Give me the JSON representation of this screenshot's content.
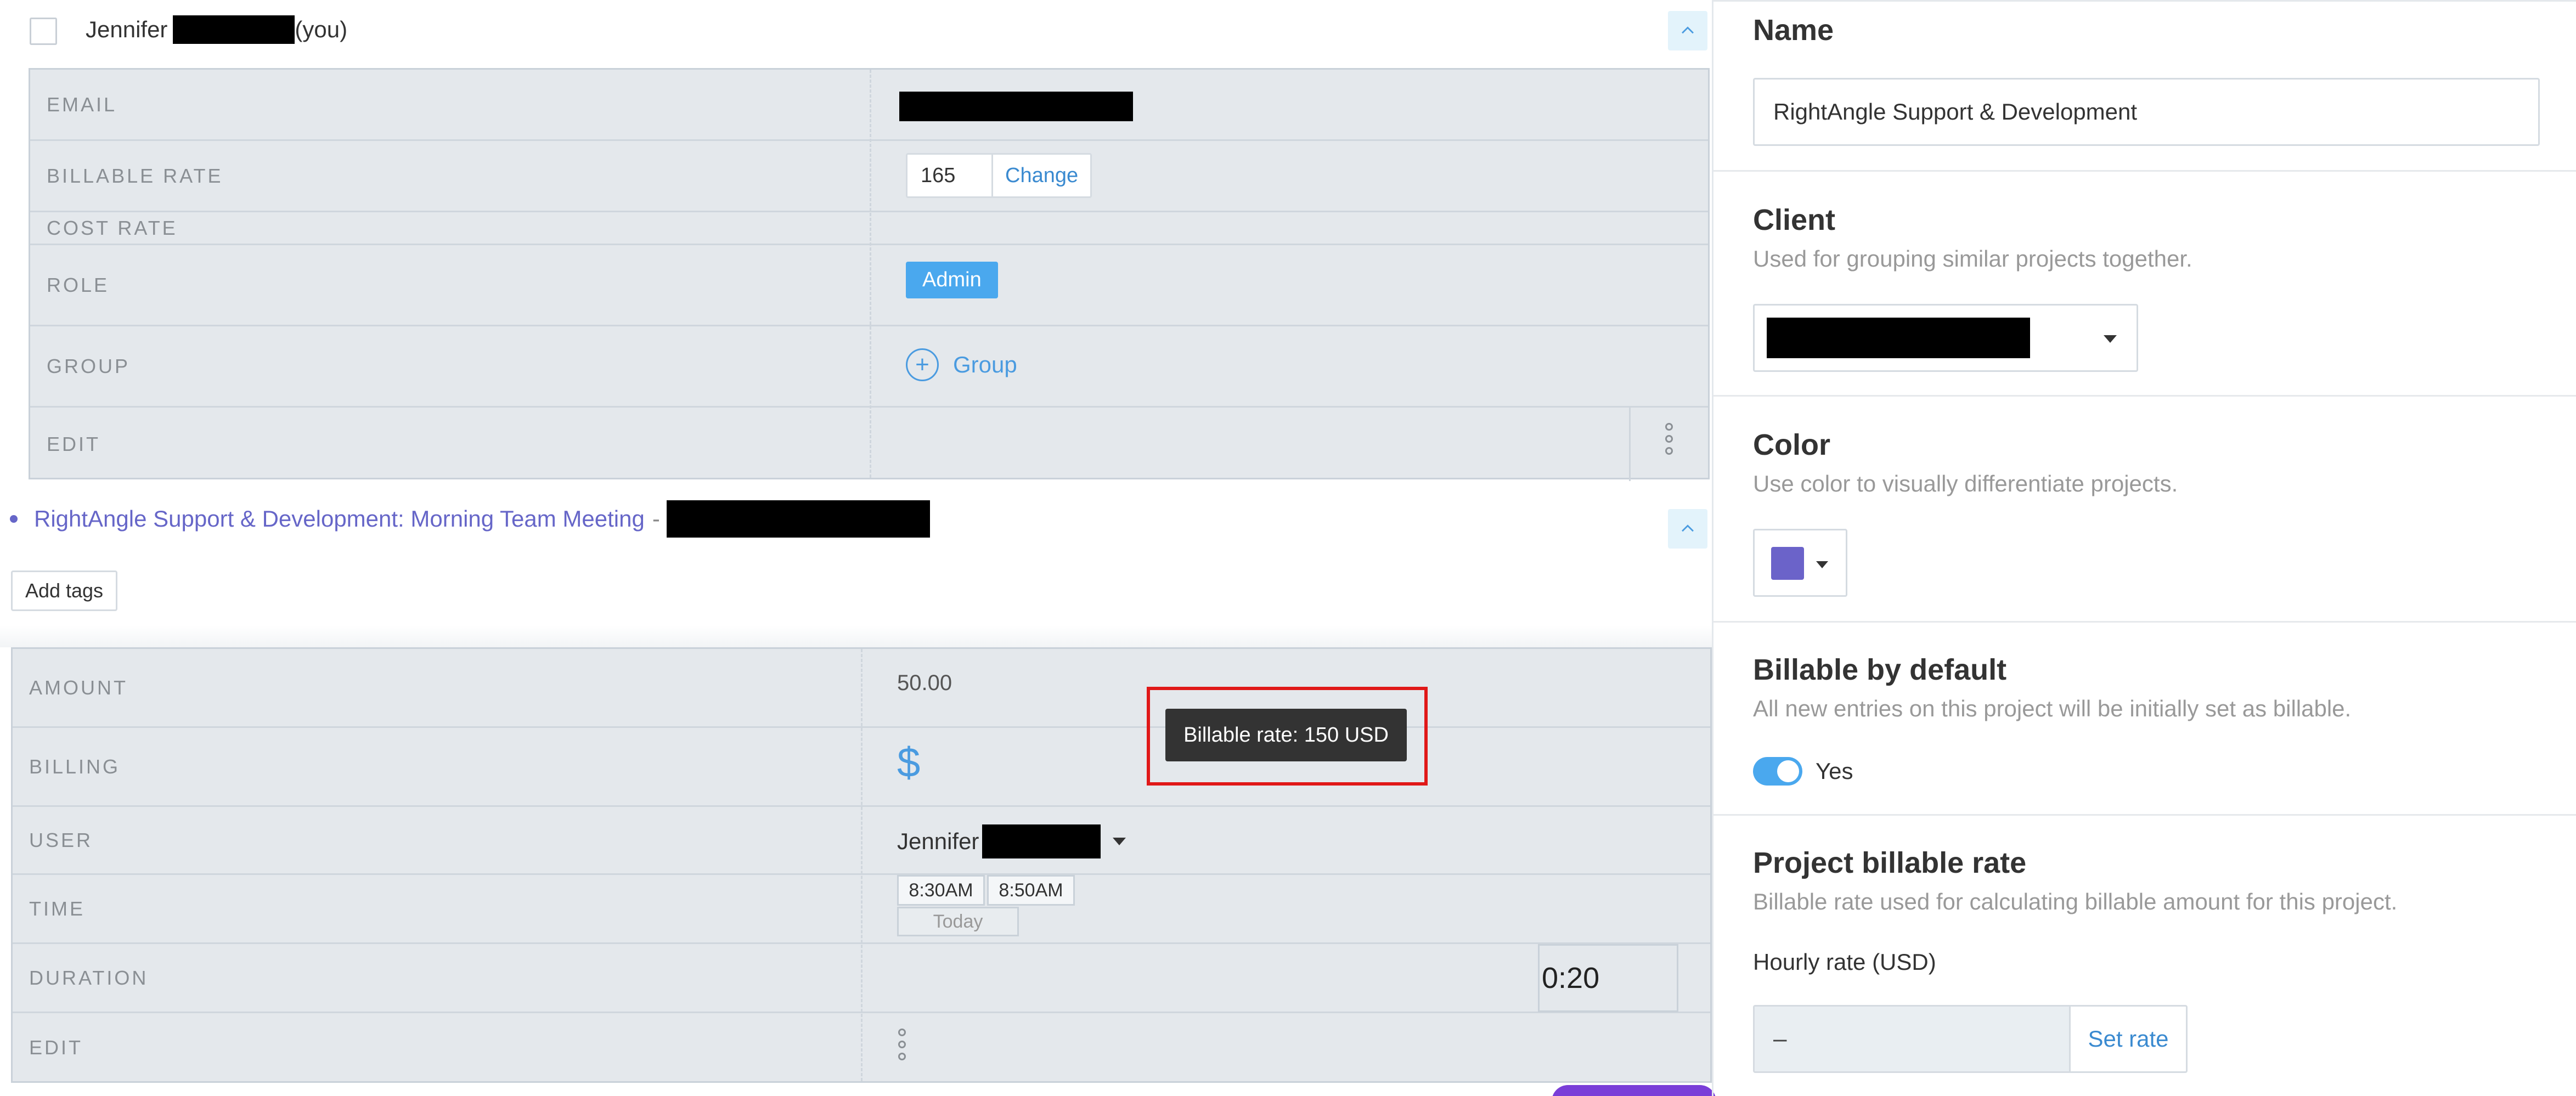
{
  "member": {
    "first_name": "Jennifer",
    "you_suffix": "(you)",
    "rows": {
      "email_label": "EMAIL",
      "billable_rate_label": "BILLABLE RATE",
      "billable_rate_value": "165",
      "change_label": "Change",
      "cost_rate_label": "COST RATE",
      "role_label": "ROLE",
      "role_value": "Admin",
      "group_label": "GROUP",
      "group_button": "Group",
      "edit_label": "EDIT"
    }
  },
  "entry": {
    "project_line": "RightAngle Support & Development: Morning Team Meeting",
    "project_separator": "-",
    "project_color": "#6666c8",
    "add_tags": "Add tags",
    "rows": {
      "amount_label": "AMOUNT",
      "amount_value": "50.00",
      "billing_label": "BILLING",
      "billing_icon": "dollar-icon",
      "user_label": "USER",
      "user_value": "Jennifer",
      "time_label": "TIME",
      "time_start": "8:30AM",
      "time_end": "8:50AM",
      "time_day": "Today",
      "duration_label": "DURATION",
      "duration_value": "0:20",
      "edit_label": "EDIT"
    },
    "tooltip": "Billable rate: 150 USD"
  },
  "project_settings": {
    "name_title": "Name",
    "name_value": "RightAngle Support & Development",
    "client_title": "Client",
    "client_desc": "Used for grouping similar projects together.",
    "color_title": "Color",
    "color_desc": "Use color to visually differentiate projects.",
    "color_value": "#6b63c9",
    "billable_title": "Billable by default",
    "billable_desc": "All new entries on this project will be initially set as billable.",
    "billable_toggle_label": "Yes",
    "billable_enabled": true,
    "rate_title": "Project billable rate",
    "rate_desc": "Billable rate used for calculating billable amount for this project.",
    "hourly_label": "Hourly rate (USD)",
    "hourly_value": "–",
    "set_rate": "Set rate"
  },
  "colors": {
    "accent_blue": "#4aa8ee",
    "link_blue": "#3a8ad0",
    "highlight_red": "#e01818"
  }
}
